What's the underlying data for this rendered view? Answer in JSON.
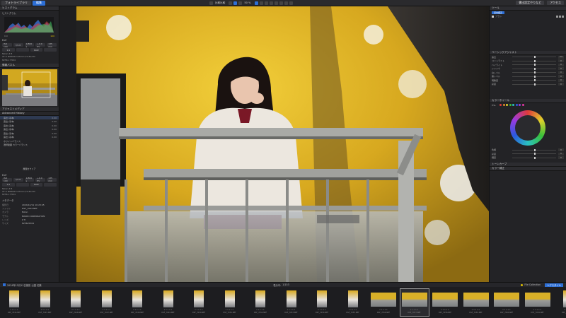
{
  "topbar": {
    "library_tab": "フォトライブラリ",
    "edit_tab": "編集",
    "compare_label": "比較比較",
    "zoom": "50 %",
    "export_label": "書出設定やりなど",
    "more_label": "アクセス"
  },
  "left": {
    "tone_title": "ヒストグラム",
    "hist_label": "ヒストグラム",
    "hist_values": [
      "0.0",
      "100"
    ],
    "exif_title": "Exif",
    "exif_row1": [
      "ISO 100",
      "f/2.8",
      "1/800 s",
      "+0.0 EV",
      "135 mm"
    ],
    "exif_row2": [
      "1/1",
      "",
      "RAW",
      ""
    ],
    "camera1": "Nikon Z 8",
    "lens1": "AF-S NIKKOR 135mm f/1.8G ED",
    "size1": "8256 x 5504",
    "nav_title": "情報パネル",
    "nav_zoom": "50%",
    "adjust_title": "アジャストメディア",
    "history_title": "Advanced History",
    "history_items": [
      {
        "label": "露出 (基本)",
        "value": "0.00"
      },
      {
        "label": "露出 (基本)",
        "value": "0.00"
      },
      {
        "label": "露出 (基本)",
        "value": "0.00"
      },
      {
        "label": "露出 (基本)",
        "value": "0.00"
      },
      {
        "label": "露出 (基本)",
        "value": "0.00"
      },
      {
        "label": "露出 (基本)",
        "value": "0.00"
      },
      {
        "label": "ホワイトバランス",
        "value": ""
      },
      {
        "label": "選択範囲 カラーバランス",
        "value": ""
      }
    ],
    "reset_label": "履歴をクリア",
    "exif2_title": "Exif",
    "exif2_row1": [
      "ISO 100",
      "f/2.8",
      "1/800 s",
      "+0.0 EV",
      "135 mm"
    ],
    "exif2_row2": [
      "1/1",
      "",
      "RAW",
      ""
    ],
    "camera2": "Nikon Z 8",
    "lens2": "AF-S NIKKOR 135mm f/1.8G ED",
    "size2": "8256 x 5504",
    "meta_title": "メタデータ",
    "meta": [
      {
        "k": "撮影日",
        "v": "2024/12/11 10:23:45"
      },
      {
        "k": "ファイル",
        "v": "DSF_7044.NEF"
      },
      {
        "k": "カメラ",
        "v": "Nikon"
      },
      {
        "k": "モデル",
        "v": "NIKON CORPORATION"
      },
      {
        "k": "レンズ",
        "v": "Z 8"
      },
      {
        "k": "サイズ",
        "v": "8256x5504"
      }
    ]
  },
  "right": {
    "header": "ツール",
    "preset": "基本補正",
    "brush": "ブラシ",
    "section1": "ベーシックアジャスト",
    "rows": [
      {
        "label": "露出",
        "value": "0.0"
      },
      {
        "label": "コントラスト",
        "value": "0"
      },
      {
        "label": "ハイライト",
        "value": "0"
      },
      {
        "label": "シャドウ",
        "value": "0"
      },
      {
        "label": "白レベル",
        "value": "0"
      },
      {
        "label": "黒レベル",
        "value": "0"
      },
      {
        "label": "明瞭度",
        "value": "0"
      },
      {
        "label": "彩度",
        "value": "0"
      }
    ],
    "section2": "カラーホイール",
    "hsl_label": "HSL",
    "rows2": [
      {
        "label": "色相",
        "value": "0"
      },
      {
        "label": "彩度",
        "value": "0"
      },
      {
        "label": "輝度",
        "value": "0"
      }
    ],
    "section3": "トーンカーブ",
    "section4": "カラー補正"
  },
  "bottom": {
    "filter_label": "2024年12月11日撮影 公園 紅葉",
    "count_label": "表示中:",
    "count_value": "1/153",
    "collection_label": "File Collection",
    "panel_label": "ヘアスタイル"
  },
  "filmstrip": [
    {
      "name": "DSF_7044.NEF",
      "type": "port"
    },
    {
      "name": "DSF_7045.NEF",
      "type": "port"
    },
    {
      "name": "DSF_7046.NEF",
      "type": "port"
    },
    {
      "name": "DSF_7047.NEF",
      "type": "port"
    },
    {
      "name": "DSF_7048.NEF",
      "type": "port"
    },
    {
      "name": "DSF_7049.NEF",
      "type": "port"
    },
    {
      "name": "DSF_7050.NEF",
      "type": "port"
    },
    {
      "name": "DSF_7051.NEF",
      "type": "port"
    },
    {
      "name": "DSF_7052.NEF",
      "type": "port"
    },
    {
      "name": "DSF_7053.NEF",
      "type": "port"
    },
    {
      "name": "DSF_7054.NEF",
      "type": "port"
    },
    {
      "name": "DSF_7055.NEF",
      "type": "port"
    },
    {
      "name": "DSF_7056.NEF",
      "type": "land"
    },
    {
      "name": "DSF_7057.NEF",
      "type": "land",
      "selected": true
    },
    {
      "name": "DSF_7058.NEF",
      "type": "land"
    },
    {
      "name": "DSF_7059.NEF",
      "type": "land"
    },
    {
      "name": "DSF_7060.NEF",
      "type": "land"
    },
    {
      "name": "DSF_7061.NEF",
      "type": "land"
    },
    {
      "name": "DSF_7062.NEF",
      "type": "port"
    }
  ],
  "colors": {
    "accent": "#2d6fd6",
    "panel": "#232326"
  }
}
